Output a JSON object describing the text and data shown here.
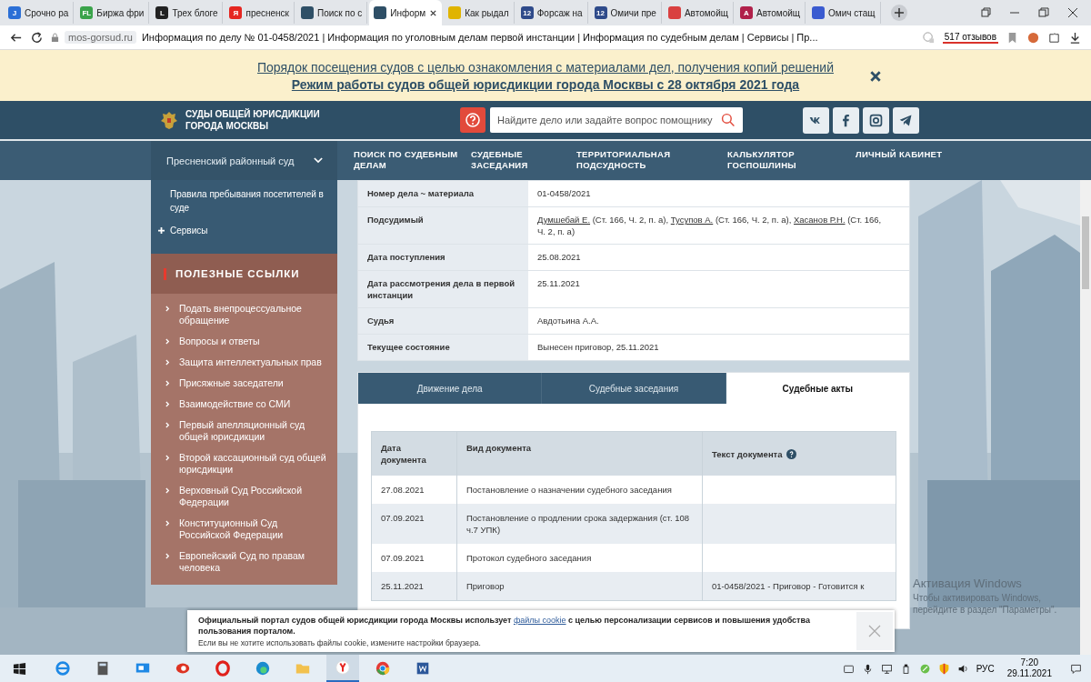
{
  "browser_tabs": [
    {
      "icon_text": "J",
      "color": "#2b6fd6",
      "title": "Срочно ра",
      "selected": false
    },
    {
      "icon_text": "FL",
      "color": "#3aa34a",
      "title": "Биржа фри",
      "selected": false
    },
    {
      "icon_text": "L",
      "color": "#222222",
      "title": "Трех блоге",
      "selected": false
    },
    {
      "icon_text": "Я",
      "color": "#e52620",
      "title": "пресненск",
      "selected": false
    },
    {
      "color": "#2e4f66",
      "title": "Поиск по с",
      "selected": false
    },
    {
      "color": "#2e4f66",
      "title": "Информ",
      "selected": true
    },
    {
      "color": "#e0b400",
      "title": "Как рыдал",
      "selected": false
    },
    {
      "icon_text": "12",
      "color": "#2e4a8a",
      "title": "Форсаж на",
      "selected": false
    },
    {
      "icon_text": "12",
      "color": "#2e4a8a",
      "title": "Омичи пре",
      "selected": false
    },
    {
      "color": "#d94040",
      "title": "Автомойщ",
      "selected": false
    },
    {
      "icon_text": "A",
      "color": "#b0204a",
      "title": "Автомойщ",
      "selected": false
    },
    {
      "color": "#3a5bd0",
      "title": "Омич стащ",
      "selected": false
    }
  ],
  "address_bar": {
    "domain": "mos-gorsud.ru",
    "page_title": "Информация по делу № 01-0458/2021 | Информация по уголовным делам первой инстанции | Информация по судебным делам | Сервисы | Пр...",
    "reviews": "517 отзывов"
  },
  "notice": {
    "links": [
      "Порядок посещения судов с целью ознакомления с материалами дел, получения копий решений",
      "Режим работы судов общей юрисдикции города Москвы с 28 октября 2021 года"
    ]
  },
  "header": {
    "logo_lines": [
      "СУДЫ ОБЩЕЙ ЮРИСДИКЦИИ",
      "ГОРОДА МОСКВЫ"
    ],
    "search_placeholder": "Найдите дело или задайте вопрос помощнику"
  },
  "nav": {
    "court": "Пресненский районный суд",
    "items": [
      "ПОИСК ПО СУДЕБНЫМ ДЕЛАМ",
      "СУДЕБНЫЕ ЗАСЕДАНИЯ",
      "ТЕРРИТОРИАЛЬНАЯ ПОДСУДНОСТЬ",
      "КАЛЬКУЛЯТОР ГОСПОШЛИНЫ",
      "ЛИЧНЫЙ КАБИНЕТ"
    ]
  },
  "sidebar": {
    "menu": [
      {
        "label": "Правила пребывания посетителей в суде",
        "kind": "link"
      },
      {
        "label": "Сервисы",
        "kind": "expandable"
      }
    ],
    "useful_links_title": "ПОЛЕЗНЫЕ ССЫЛКИ",
    "useful_links": [
      "Подать внепроцессуальное обращение",
      "Вопросы и ответы",
      "Защита интеллектуальных прав",
      "Присяжные заседатели",
      "Взаимодействие со СМИ",
      "Первый апелляционный суд общей юрисдикции",
      "Второй кассационный суд общей юрисдикции",
      "Верховный Суд Российской Федерации",
      "Конституционный Суд Российской Федерации",
      "Европейский Суд по правам человека"
    ]
  },
  "case_info": [
    {
      "label": "Номер дела ~ материала",
      "value": [
        {
          "text": "01-0458/2021",
          "kind": "text"
        }
      ]
    },
    {
      "label": "Подсудимый",
      "value": [
        {
          "text": "Думшебай Е.",
          "kind": "link"
        },
        {
          "text": " (Ст. 166, Ч. 2, п. а), ",
          "kind": "text"
        },
        {
          "text": "Тусупов А.",
          "kind": "link"
        },
        {
          "text": " (Ст. 166, Ч. 2, п. а), ",
          "kind": "text"
        },
        {
          "text": "Хасанов Р.Н.",
          "kind": "link"
        },
        {
          "text": " (Ст. 166, Ч. 2, п. а)",
          "kind": "text"
        }
      ]
    },
    {
      "label": "Дата поступления",
      "value": [
        {
          "text": "25.08.2021",
          "kind": "text"
        }
      ]
    },
    {
      "label": "Дата рассмотрения дела в первой инстанции",
      "value": [
        {
          "text": "25.11.2021",
          "kind": "text"
        }
      ]
    },
    {
      "label": "Судья",
      "value": [
        {
          "text": "Авдотьина А.А.",
          "kind": "text"
        }
      ]
    },
    {
      "label": "Текущее состояние",
      "value": [
        {
          "text": "Вынесен приговор, 25.11.2021",
          "kind": "text"
        }
      ]
    }
  ],
  "case_tabs": [
    {
      "label": "Движение дела",
      "selected": false
    },
    {
      "label": "Судебные заседания",
      "selected": false
    },
    {
      "label": "Судебные акты",
      "selected": true
    }
  ],
  "acts_table": {
    "columns": [
      "Дата документа",
      "Вид документа",
      "Текст документа"
    ],
    "rows": [
      [
        "27.08.2021",
        "Постановление о назначении судебного заседания",
        ""
      ],
      [
        "07.09.2021",
        "Постановление о продлении срока задержания (ст. 108 ч.7 УПК)",
        ""
      ],
      [
        "07.09.2021",
        "Протокол судебного заседания",
        ""
      ],
      [
        "25.11.2021",
        "Приговор",
        "01-0458/2021 - Приговор - Готовится к"
      ]
    ]
  },
  "cookie_banner": {
    "before": "Официальный портал судов общей юрисдикции города Москвы использует ",
    "link": "файлы cookie",
    "after": " с целью персонализации сервисов и повышения удобства пользования порталом.",
    "note": "Если вы не хотите использовать файлы cookie, измените настройки браузера."
  },
  "os_overlay": {
    "title": "Активация Windows",
    "text": "Чтобы активировать Windows, перейдите в раздел \"Параметры\"."
  },
  "taskbar": {
    "apps": [
      {
        "kind": "ie",
        "selected": false
      },
      {
        "kind": "calculator",
        "selected": false
      },
      {
        "kind": "monitor",
        "selected": false
      },
      {
        "kind": "red",
        "selected": false
      },
      {
        "kind": "opera",
        "selected": false
      },
      {
        "kind": "edge",
        "selected": false
      },
      {
        "kind": "folder",
        "selected": false
      },
      {
        "kind": "yandex",
        "selected": true
      },
      {
        "kind": "chrome",
        "selected": false
      },
      {
        "kind": "word",
        "selected": false
      }
    ],
    "language": "РУС",
    "time": "7:20",
    "date": "29.11.2021"
  }
}
